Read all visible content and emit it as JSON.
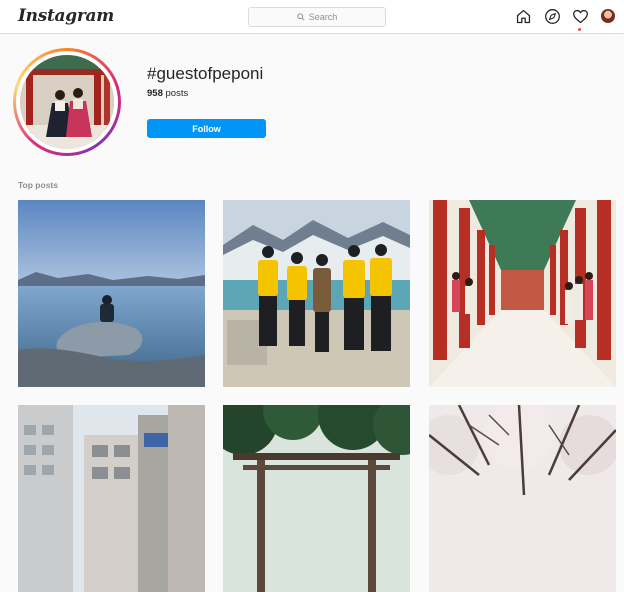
{
  "header": {
    "logo_text": "Instagram",
    "search_placeholder": "Search",
    "nav_icons": [
      "home-icon",
      "explore-icon",
      "activity-heart-icon",
      "profile-avatar"
    ]
  },
  "hashtag": {
    "title": "#guestofpeponi",
    "post_count": "958",
    "post_suffix": " posts",
    "follow_label": "Follow"
  },
  "top_posts_label": "Top posts",
  "colors": {
    "accent": "#0095f6",
    "notification": "#ed4956",
    "border": "#dbdbdb"
  }
}
